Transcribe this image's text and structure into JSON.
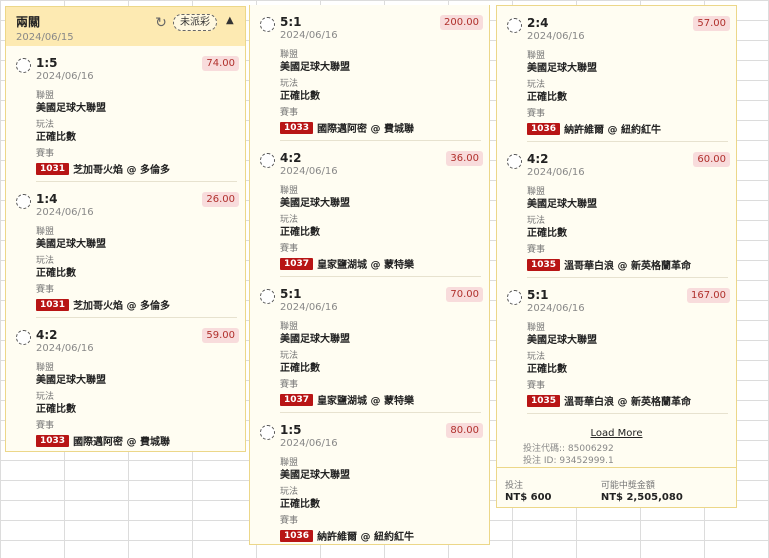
{
  "header": {
    "title": "兩關",
    "date": "2024/06/15",
    "status_pill": "未派彩"
  },
  "icons": {
    "refresh": "refresh-icon",
    "collapse": "chevron-up-icon",
    "select": "radio-circle-icon"
  },
  "labels": {
    "league": "聯盟",
    "play": "玩法",
    "event": "賽事"
  },
  "columns": [
    {
      "entries": [
        {
          "score": "1:5",
          "date": "2024/06/16",
          "amount": "74.00",
          "league": "美國足球大聯盟",
          "play": "正確比數",
          "code": "1031",
          "match": "芝加哥火焰 @ 多倫多"
        },
        {
          "score": "1:4",
          "date": "2024/06/16",
          "amount": "26.00",
          "league": "美國足球大聯盟",
          "play": "正確比數",
          "code": "1031",
          "match": "芝加哥火焰 @ 多倫多"
        },
        {
          "score": "4:2",
          "date": "2024/06/16",
          "amount": "59.00",
          "league": "美國足球大聯盟",
          "play": "正確比數",
          "code": "1033",
          "match": "國際邁阿密 @ 費城聯"
        }
      ]
    },
    {
      "entries": [
        {
          "score": "5:1",
          "date": "2024/06/16",
          "amount": "200.00",
          "league": "美國足球大聯盟",
          "play": "正確比數",
          "code": "1033",
          "match": "國際邁阿密 @ 費城聯"
        },
        {
          "score": "4:2",
          "date": "2024/06/16",
          "amount": "36.00",
          "league": "美國足球大聯盟",
          "play": "正確比數",
          "code": "1037",
          "match": "皇家鹽湖城 @ 蒙特樂"
        },
        {
          "score": "5:1",
          "date": "2024/06/16",
          "amount": "70.00",
          "league": "美國足球大聯盟",
          "play": "正確比數",
          "code": "1037",
          "match": "皇家鹽湖城 @ 蒙特樂"
        },
        {
          "score": "1:5",
          "date": "2024/06/16",
          "amount": "80.00",
          "league": "美國足球大聯盟",
          "play": "正確比數",
          "code": "1036",
          "match": "納許維爾 @ 紐約紅牛"
        }
      ]
    },
    {
      "entries": [
        {
          "score": "2:4",
          "date": "2024/06/16",
          "amount": "57.00",
          "league": "美國足球大聯盟",
          "play": "正確比數",
          "code": "1036",
          "match": "納許維爾 @ 紐約紅牛"
        },
        {
          "score": "4:2",
          "date": "2024/06/16",
          "amount": "60.00",
          "league": "美國足球大聯盟",
          "play": "正確比數",
          "code": "1035",
          "match": "溫哥華白浪 @ 新英格蘭革命"
        },
        {
          "score": "5:1",
          "date": "2024/06/16",
          "amount": "167.00",
          "league": "美國足球大聯盟",
          "play": "正確比數",
          "code": "1035",
          "match": "溫哥華白浪 @ 新英格蘭革命"
        }
      ]
    }
  ],
  "load_more": "Load More",
  "meta": {
    "bet_code": "投注代碼:: 85006292",
    "bet_id": "投注 ID: 93452999.1"
  },
  "footer": {
    "stake_label": "投注",
    "stake_value": "NT$ 600",
    "payout_label": "可能中獎金額",
    "payout_value": "NT$ 2,505,080"
  }
}
